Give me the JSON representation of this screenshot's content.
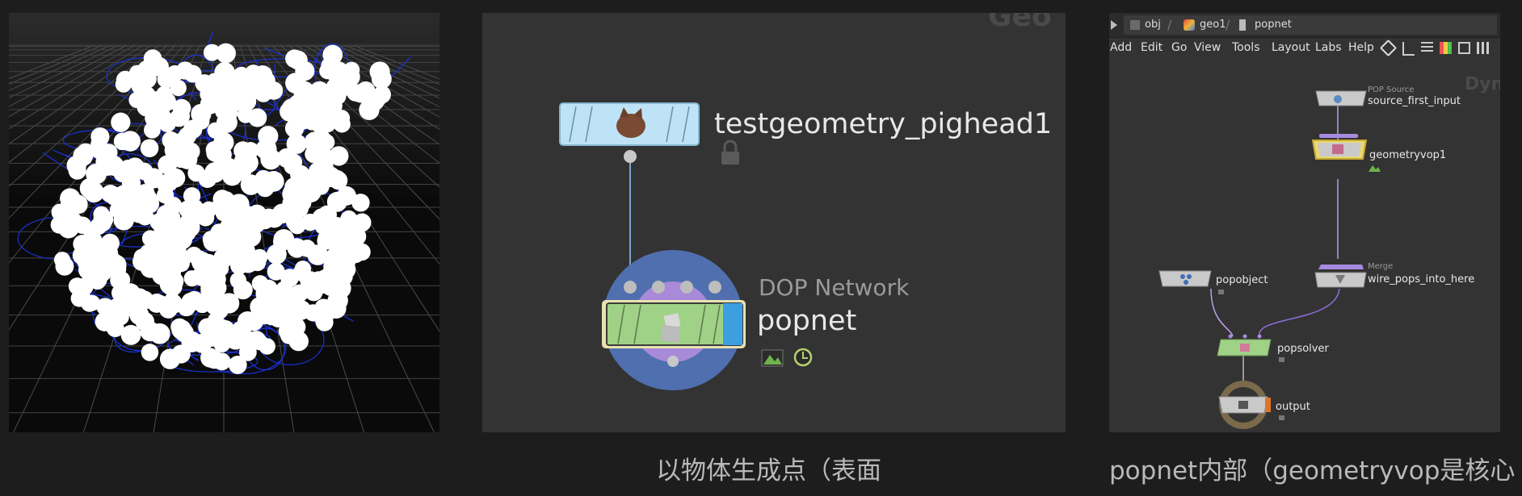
{
  "left_viewport": {
    "bg_top": "#2a2a2a",
    "bg_bottom": "#0b0b0b",
    "wire_color": "#1a32d8",
    "point_color": "#ffffff"
  },
  "middle_network": {
    "source_node": {
      "name": "testgeometry_pighead1"
    },
    "dop_node": {
      "type_label": "DOP Network",
      "name": "popnet"
    },
    "watermark": "Geo"
  },
  "right_network": {
    "breadcrumb": [
      "obj",
      "geo1",
      "popnet"
    ],
    "menu": [
      "Add",
      "Edit",
      "Go",
      "View",
      "Tools",
      "Layout",
      "Labs",
      "Help"
    ],
    "corner_label": "Dyna",
    "nodes": {
      "source_first_input": {
        "type": "POP Source",
        "name": "source_first_input"
      },
      "geometryvop1": {
        "name": "geometryvop1"
      },
      "popobject": {
        "name": "popobject"
      },
      "wire_pops_into_here": {
        "type": "Merge",
        "name": "wire_pops_into_here"
      },
      "popsolver": {
        "name": "popsolver"
      },
      "output": {
        "name": "output"
      }
    }
  },
  "captions": {
    "middle": "以物体生成点（表面",
    "right": "popnet内部（geometryvop是核心"
  },
  "colors": {
    "page_bg": "#1d1d1d",
    "net_bg": "#333333",
    "green_node": "#9fd186",
    "blue_node": "#bfe3f6",
    "purple": "#a78be0"
  }
}
